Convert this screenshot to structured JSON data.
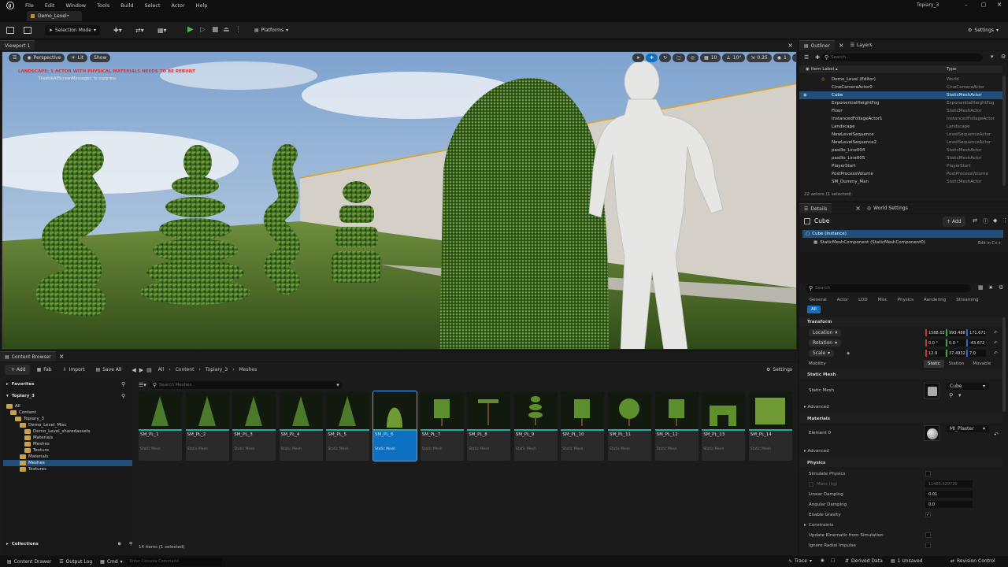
{
  "menu": [
    "File",
    "Edit",
    "Window",
    "Tools",
    "Build",
    "Select",
    "Actor",
    "Help"
  ],
  "project_name": "Topiary_3",
  "level_tab": "Demo_Level•",
  "toolbar": {
    "selection_mode": "Selection Mode",
    "platforms": "Platforms",
    "settings": "Settings"
  },
  "viewport": {
    "tab": "Viewport 1",
    "perspective": "Perspective",
    "lit": "Lit",
    "show": "Show",
    "warning": "LANDSCAPE: 1 ACTOR WITH PHYSICAL MATERIALS NEEDS TO BE REBUILT",
    "warning_sub": "'DisableAllScreenMessages' to suppress",
    "snap_grid": "10",
    "snap_angle": "10°",
    "snap_scale": "0.25",
    "cam_speed": "1"
  },
  "outliner": {
    "tab": "Outliner",
    "layers_tab": "Layers",
    "search_placeholder": "Search...",
    "col_label": "Item Label ▴",
    "col_type": "Type",
    "rows": [
      {
        "label": "Demo_Level (Editor)",
        "type": "World"
      },
      {
        "label": "CineCameraActor0",
        "type": "CineCameraActor"
      },
      {
        "label": "Cube",
        "type": "StaticMeshActor"
      },
      {
        "label": "ExponentialHeightFog",
        "type": "ExponentialHeightFog"
      },
      {
        "label": "Floor",
        "type": "StaticMeshActor"
      },
      {
        "label": "InstancedFoliageActor1",
        "type": "InstancedFoliageActor"
      },
      {
        "label": "Landscape",
        "type": "Landscape"
      },
      {
        "label": "NewLevelSequence",
        "type": "LevelSequenceActor"
      },
      {
        "label": "NewLevelSequence2",
        "type": "LevelSequenceActor"
      },
      {
        "label": "pasillo_Line004",
        "type": "StaticMeshActor"
      },
      {
        "label": "pasillo_Line005",
        "type": "StaticMeshActor"
      },
      {
        "label": "PlayerStart",
        "type": "PlayerStart"
      },
      {
        "label": "PostProcessVolume",
        "type": "PostProcessVolume"
      },
      {
        "label": "SM_Dummy_Man",
        "type": "StaticMeshActor"
      }
    ],
    "count": "22 actors (1 selected)"
  },
  "details": {
    "tab": "Details",
    "world_tab": "World Settings",
    "actor": "Cube",
    "add": "+ Add",
    "instance": "Cube (Instance)",
    "component": "StaticMeshComponent (StaticMeshComponent0)",
    "edit_cpp": "Edit in C++",
    "search_placeholder": "Search",
    "filters": [
      "General",
      "Actor",
      "LOD",
      "Misc",
      "Physics",
      "Rendering",
      "Streaming"
    ],
    "all": "All",
    "transform": "Transform",
    "location": "Location",
    "rotation": "Rotation",
    "scale": "Scale",
    "mobility": "Mobility",
    "loc": [
      "1588.02",
      "993.488",
      "171.671"
    ],
    "rot": [
      "0.0 °",
      "0.0 °",
      "-43.672"
    ],
    "scl": [
      "12.9",
      "37.4932",
      "7.0"
    ],
    "mob": [
      "Static",
      "Station",
      "Movable"
    ],
    "static_mesh_sec": "Static Mesh",
    "static_mesh": "Static Mesh",
    "mesh_value": "Cube",
    "advanced": "Advanced",
    "materials_sec": "Materials",
    "element0": "Element 0",
    "mat_value": "MI_Plaster",
    "physics_sec": "Physics",
    "simulate": "Simulate Physics",
    "mass": "Mass (kg)",
    "mass_val": "11485.629726",
    "linear": "Linear Damping",
    "linear_val": "0.01",
    "angular": "Angular Damping",
    "angular_val": "0.0",
    "gravity": "Enable Gravity",
    "constraints": "Constraints",
    "kinematic": "Update Kinematic from Simulation",
    "radial": "Ignore Radial Impulse"
  },
  "content": {
    "tab": "Content Browser",
    "add": "+ Add",
    "fab": "Fab",
    "import": "Import",
    "save_all": "Save All",
    "crumbs": [
      "All",
      "Content",
      "Topiary_3",
      "Meshes"
    ],
    "settings": "Settings",
    "favorites": "Favorites",
    "project": "Topiary_3",
    "search_placeholder": "Search Meshes",
    "collections": "Collections",
    "count": "14 items (1 selected)",
    "tree": [
      "All",
      "Content",
      "Topiary_3",
      "Demo_Level_Misc",
      "Demo_Level_sharedassets",
      "Materials",
      "Meshes",
      "Texture",
      "Materials",
      "Meshes",
      "Textures"
    ],
    "assets": [
      "SM_PL_1",
      "SM_PL_2",
      "SM_PL_3",
      "SM_PL_4",
      "SM_PL_5",
      "SM_PL_6",
      "SM_PL_7",
      "SM_PL_8",
      "SM_PL_9",
      "SM_PL_10",
      "SM_PL_11",
      "SM_PL_12",
      "SM_PL_13",
      "SM_PL_14"
    ],
    "asset_type": "Static Mesh"
  },
  "status": {
    "drawer": "Content Drawer",
    "output": "Output Log",
    "cmd": "Cmd",
    "console_placeholder": "Enter Console Command",
    "trace": "Trace",
    "derived": "Derived Data",
    "unsaved": "1 Unsaved",
    "revision": "Revision Control"
  },
  "colors": {
    "accent": "#0e70c0",
    "selected_row": "#1f4f7a",
    "play_green": "#43c24a",
    "foliage": "#3d6b22",
    "warning": "#e03030"
  }
}
